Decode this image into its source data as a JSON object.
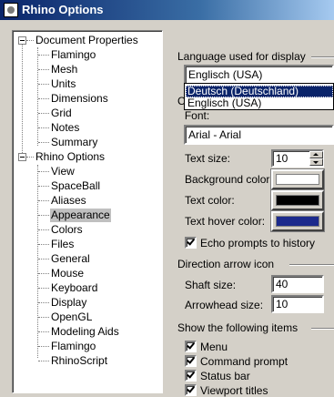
{
  "window": {
    "title": "Rhino Options"
  },
  "tree": {
    "document_properties": {
      "label": "Document Properties",
      "children": [
        "Flamingo",
        "Mesh",
        "Units",
        "Dimensions",
        "Grid",
        "Notes",
        "Summary"
      ]
    },
    "rhino_options": {
      "label": "Rhino Options",
      "children": [
        "View",
        "SpaceBall",
        "Aliases",
        "Appearance",
        "Colors",
        "Files",
        "General",
        "Mouse",
        "Keyboard",
        "Display",
        "OpenGL",
        "Modeling Aids",
        "Flamingo",
        "RhinoScript"
      ],
      "selected": "Appearance"
    }
  },
  "appearance": {
    "language_group": "Language used for display",
    "language_value": "Englisch (USA)",
    "language_options": [
      "Deutsch (Deutschland)",
      "Englisch (USA)"
    ],
    "command_prompt_group_partial": "C",
    "font_label": "Font:",
    "font_value": "Arial - Arial",
    "text_size_label": "Text size:",
    "text_size_value": "10",
    "background_color_label": "Background color:",
    "text_color_label": "Text color:",
    "text_hover_color_label": "Text hover color:",
    "echo_label": "Echo prompts to history",
    "direction_group": "Direction arrow icon",
    "shaft_label": "Shaft size:",
    "shaft_value": "40",
    "arrowhead_label": "Arrowhead size:",
    "arrowhead_value": "10",
    "show_group": "Show the following items",
    "show_items": [
      "Menu",
      "Command prompt",
      "Status bar",
      "Viewport titles"
    ]
  },
  "colors": {
    "title_bar": "#0a246a",
    "background_color": "#ffffff",
    "text_color": "#000000",
    "text_hover_color": "#1c2a8c",
    "selection": "#0a246a"
  },
  "icons": {
    "window": "rhino-app-icon"
  }
}
